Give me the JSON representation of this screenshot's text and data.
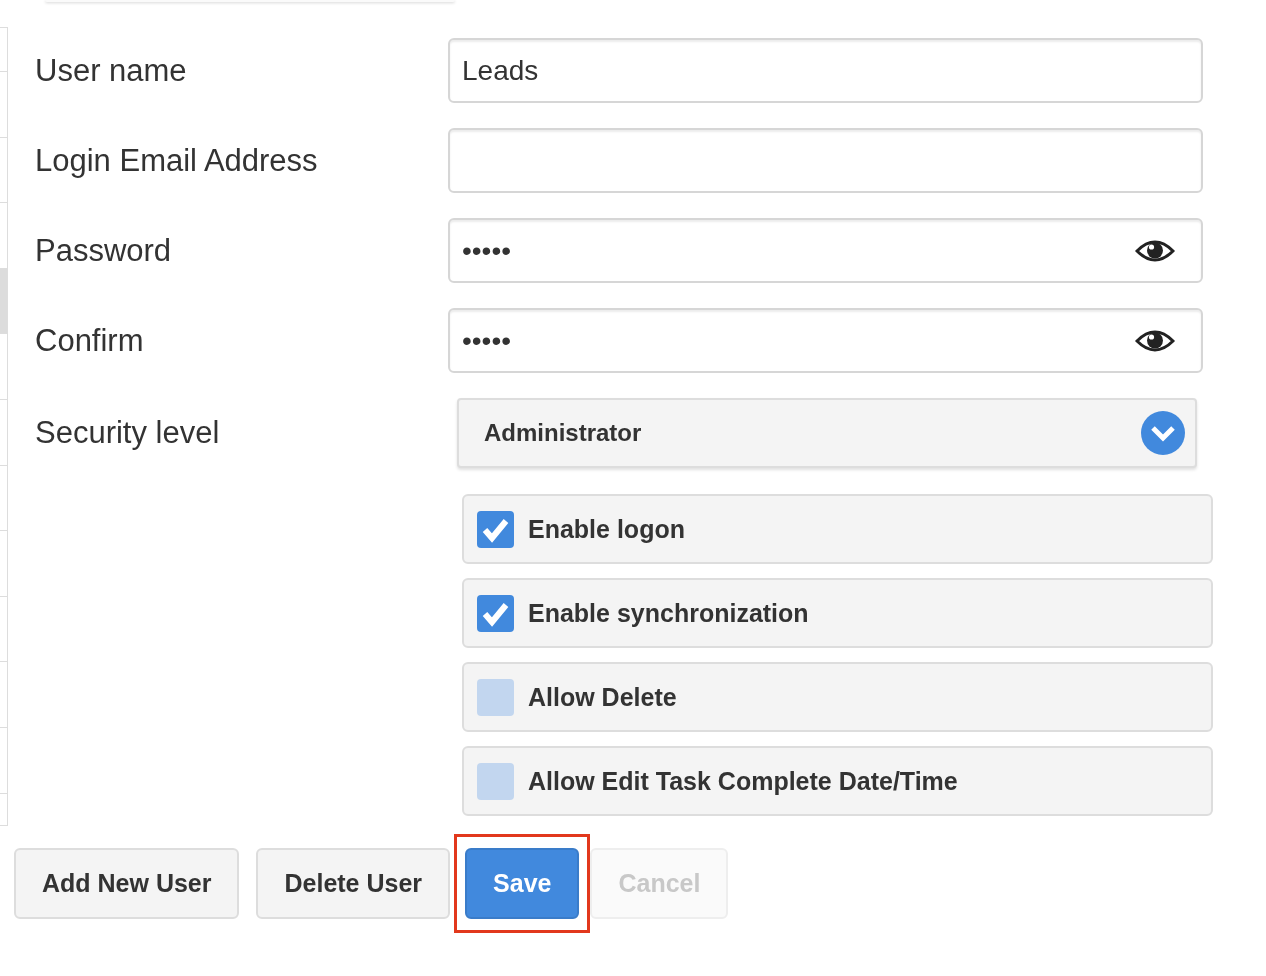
{
  "user_list": {
    "rows": [
      {
        "selected": false
      },
      {
        "selected": false
      },
      {
        "selected": false
      },
      {
        "selected": false
      },
      {
        "selected": true
      },
      {
        "selected": false
      },
      {
        "selected": false
      },
      {
        "selected": false
      },
      {
        "selected": false
      },
      {
        "selected": false
      },
      {
        "selected": false
      },
      {
        "selected": false
      },
      {
        "selected": false
      }
    ]
  },
  "fields": [
    {
      "label": "User name",
      "kind": "text",
      "value": "Leads"
    },
    {
      "label": "Login Email Address",
      "kind": "text"
    },
    {
      "label": "Password",
      "kind": "password",
      "value": "•••••"
    },
    {
      "label": "Confirm",
      "kind": "password",
      "value": "•••••"
    }
  ],
  "security_level": {
    "label": "Security level",
    "value": "Administrator"
  },
  "options": [
    {
      "label": "Enable logon",
      "checked": true
    },
    {
      "label": "Enable synchronization",
      "checked": true
    },
    {
      "label": "Allow Delete",
      "checked": false
    },
    {
      "label": "Allow Edit Task Complete Date/Time",
      "checked": false
    }
  ],
  "buttons": [
    {
      "label": "Add New User",
      "kind": "default",
      "disabled": false,
      "highlighted": false
    },
    {
      "label": "Delete User",
      "kind": "default",
      "disabled": false,
      "highlighted": false
    },
    {
      "label": "Save",
      "kind": "primary",
      "disabled": false,
      "highlighted": true
    },
    {
      "label": "Cancel",
      "kind": "default",
      "disabled": true,
      "highlighted": false
    }
  ]
}
